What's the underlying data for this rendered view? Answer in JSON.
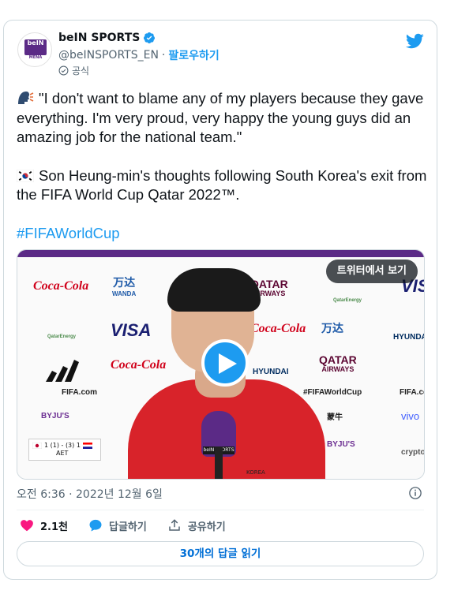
{
  "author": {
    "name": "beIN SPORTS",
    "handle": "@beINSPORTS_EN",
    "separator": "·",
    "follow_label": "팔로우하기",
    "official_label": "공식",
    "avatar_text": "beIN",
    "avatar_subtext": "MENA"
  },
  "tweet": {
    "quote": "\"I don't want to blame any of my players because they gave everything. I'm very proud, very happy the young guys did an amazing job for the national team.\"",
    "summary": "Son Heung-min's thoughts following South Korea's exit from the FIFA World Cup Qatar 2022™.",
    "hashtag": "#FIFAWorldCup"
  },
  "media": {
    "view_on_twitter": "트위터에서 보기",
    "scoreboard": "1 (1) - (3) 1",
    "scoreboard_sub": "AET",
    "mic_label": "beIN SPORTS",
    "sponsors": {
      "coca": "Coca-Cola",
      "visa": "VISA",
      "qatar": "QATAR",
      "qatar_sub": "AIRWAYS",
      "hyundai": "HYUNDAI",
      "wanda": "万达",
      "wanda_sub": "WANDA",
      "fifa": "FIFA.com",
      "hashtag": "#FIFAWorldCup",
      "byjus": "BYJU'S",
      "vivo": "vivo",
      "mengniu": "蒙牛",
      "qatarenergy": "QatarEnergy",
      "crypto": "crypto",
      "korea": "KOREA"
    }
  },
  "timestamp": "오전 6:36 · 2022년 12월 6일",
  "actions": {
    "likes": "2.1천",
    "reply": "답글하기",
    "share": "공유하기"
  },
  "read_replies": "30개의 답글 읽기",
  "colors": {
    "accent": "#1d9bf0",
    "like": "#f91880",
    "text": "#0f1419",
    "secondary": "#536471"
  }
}
